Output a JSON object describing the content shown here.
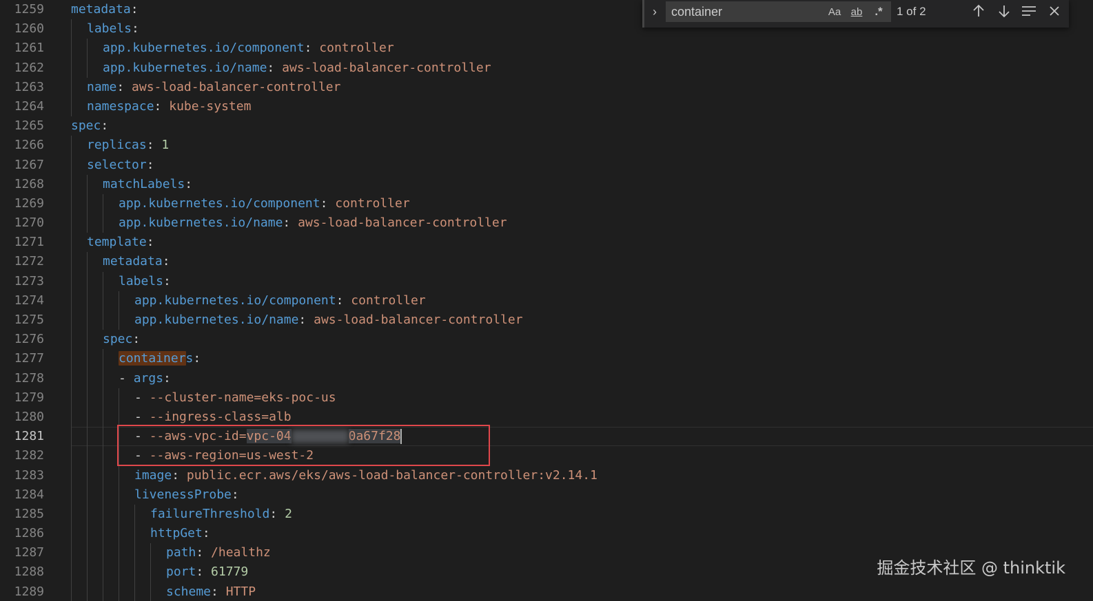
{
  "editor": {
    "current_line": "1281",
    "lines": [
      {
        "n": "1259",
        "indent": 0,
        "tokens": [
          [
            "k",
            "metadata"
          ],
          [
            "p",
            ":"
          ]
        ]
      },
      {
        "n": "1260",
        "indent": 1,
        "tokens": [
          [
            "k",
            "labels"
          ],
          [
            "p",
            ":"
          ]
        ]
      },
      {
        "n": "1261",
        "indent": 2,
        "tokens": [
          [
            "k",
            "app.kubernetes.io/component"
          ],
          [
            "p",
            ": "
          ],
          [
            "s",
            "controller"
          ]
        ]
      },
      {
        "n": "1262",
        "indent": 2,
        "tokens": [
          [
            "k",
            "app.kubernetes.io/name"
          ],
          [
            "p",
            ": "
          ],
          [
            "s",
            "aws-load-balancer-controller"
          ]
        ]
      },
      {
        "n": "1263",
        "indent": 1,
        "tokens": [
          [
            "k",
            "name"
          ],
          [
            "p",
            ": "
          ],
          [
            "s",
            "aws-load-balancer-controller"
          ]
        ]
      },
      {
        "n": "1264",
        "indent": 1,
        "tokens": [
          [
            "k",
            "namespace"
          ],
          [
            "p",
            ": "
          ],
          [
            "s",
            "kube-system"
          ]
        ]
      },
      {
        "n": "1265",
        "indent": 0,
        "tokens": [
          [
            "k",
            "spec"
          ],
          [
            "p",
            ":"
          ]
        ]
      },
      {
        "n": "1266",
        "indent": 1,
        "tokens": [
          [
            "k",
            "replicas"
          ],
          [
            "p",
            ": "
          ],
          [
            "n",
            "1"
          ]
        ]
      },
      {
        "n": "1267",
        "indent": 1,
        "tokens": [
          [
            "k",
            "selector"
          ],
          [
            "p",
            ":"
          ]
        ]
      },
      {
        "n": "1268",
        "indent": 2,
        "tokens": [
          [
            "k",
            "matchLabels"
          ],
          [
            "p",
            ":"
          ]
        ]
      },
      {
        "n": "1269",
        "indent": 3,
        "tokens": [
          [
            "k",
            "app.kubernetes.io/component"
          ],
          [
            "p",
            ": "
          ],
          [
            "s",
            "controller"
          ]
        ]
      },
      {
        "n": "1270",
        "indent": 3,
        "tokens": [
          [
            "k",
            "app.kubernetes.io/name"
          ],
          [
            "p",
            ": "
          ],
          [
            "s",
            "aws-load-balancer-controller"
          ]
        ]
      },
      {
        "n": "1271",
        "indent": 1,
        "tokens": [
          [
            "k",
            "template"
          ],
          [
            "p",
            ":"
          ]
        ]
      },
      {
        "n": "1272",
        "indent": 2,
        "tokens": [
          [
            "k",
            "metadata"
          ],
          [
            "p",
            ":"
          ]
        ]
      },
      {
        "n": "1273",
        "indent": 3,
        "tokens": [
          [
            "k",
            "labels"
          ],
          [
            "p",
            ":"
          ]
        ]
      },
      {
        "n": "1274",
        "indent": 4,
        "tokens": [
          [
            "k",
            "app.kubernetes.io/component"
          ],
          [
            "p",
            ": "
          ],
          [
            "s",
            "controller"
          ]
        ]
      },
      {
        "n": "1275",
        "indent": 4,
        "tokens": [
          [
            "k",
            "app.kubernetes.io/name"
          ],
          [
            "p",
            ": "
          ],
          [
            "s",
            "aws-load-balancer-controller"
          ]
        ]
      },
      {
        "n": "1276",
        "indent": 2,
        "tokens": [
          [
            "k",
            "spec"
          ],
          [
            "p",
            ":"
          ]
        ]
      },
      {
        "n": "1277",
        "indent": 3,
        "tokens": [
          [
            "k match",
            "container"
          ],
          [
            "k",
            "s"
          ],
          [
            "p",
            ":"
          ]
        ]
      },
      {
        "n": "1278",
        "indent": 3,
        "tokens": [
          [
            "p",
            "- "
          ],
          [
            "k",
            "args"
          ],
          [
            "p",
            ":"
          ]
        ]
      },
      {
        "n": "1279",
        "indent": 4,
        "tokens": [
          [
            "p",
            "- "
          ],
          [
            "s",
            "--cluster-name=eks-poc-us"
          ]
        ]
      },
      {
        "n": "1280",
        "indent": 4,
        "tokens": [
          [
            "p",
            "- "
          ],
          [
            "s",
            "--ingress-class=alb"
          ]
        ]
      },
      {
        "n": "1281",
        "indent": 4,
        "tokens": [
          [
            "p",
            "- "
          ],
          [
            "s",
            "--aws-vpc-id="
          ],
          [
            "s sel",
            "vpc-04"
          ],
          [
            "blur",
            ""
          ],
          [
            "s sel",
            "0a67f28"
          ],
          [
            "cursor",
            ""
          ]
        ]
      },
      {
        "n": "1282",
        "indent": 4,
        "tokens": [
          [
            "p",
            "- "
          ],
          [
            "s",
            "--aws-region=us-west-2"
          ]
        ]
      },
      {
        "n": "1283",
        "indent": 4,
        "tokens": [
          [
            "k",
            "image"
          ],
          [
            "p",
            ": "
          ],
          [
            "s",
            "public.ecr.aws/eks/aws-load-balancer-controller:v2.14.1"
          ]
        ]
      },
      {
        "n": "1284",
        "indent": 4,
        "tokens": [
          [
            "k",
            "livenessProbe"
          ],
          [
            "p",
            ":"
          ]
        ]
      },
      {
        "n": "1285",
        "indent": 5,
        "tokens": [
          [
            "k",
            "failureThreshold"
          ],
          [
            "p",
            ": "
          ],
          [
            "n",
            "2"
          ]
        ]
      },
      {
        "n": "1286",
        "indent": 5,
        "tokens": [
          [
            "k",
            "httpGet"
          ],
          [
            "p",
            ":"
          ]
        ]
      },
      {
        "n": "1287",
        "indent": 6,
        "tokens": [
          [
            "k",
            "path"
          ],
          [
            "p",
            ": "
          ],
          [
            "s",
            "/healthz"
          ]
        ]
      },
      {
        "n": "1288",
        "indent": 6,
        "tokens": [
          [
            "k",
            "port"
          ],
          [
            "p",
            ": "
          ],
          [
            "n",
            "61779"
          ]
        ]
      },
      {
        "n": "1289",
        "indent": 6,
        "tokens": [
          [
            "k",
            "scheme"
          ],
          [
            "p",
            ": "
          ],
          [
            "s",
            "HTTP"
          ]
        ]
      }
    ]
  },
  "find_widget": {
    "toggle_icon": "chevron-right-icon",
    "query": "container",
    "match_case_label": "Aa",
    "whole_word_label": "ab",
    "regex_label": ".*",
    "match_count": "1 of 2",
    "prev_icon": "arrow-up-icon",
    "next_icon": "arrow-down-icon",
    "selection_icon": "find-in-selection-icon",
    "close_icon": "close-icon"
  },
  "watermark": "掘金技术社区 @ thinktik",
  "colors": {
    "background": "#1e1e1e",
    "key": "#569cd6",
    "string": "#ce9178",
    "number": "#b5cea8",
    "find_match": "#613214",
    "annotation_box": "#e0474b"
  }
}
